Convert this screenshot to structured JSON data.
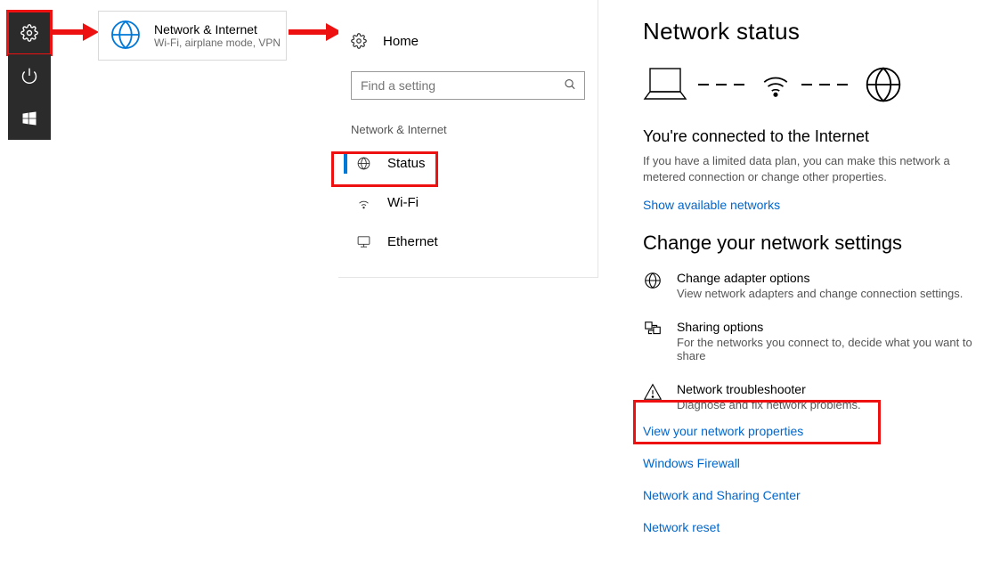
{
  "start": {
    "settings_icon": "settings",
    "power_icon": "power",
    "windows_icon": "windows"
  },
  "category_tile": {
    "title": "Network & Internet",
    "subtitle": "Wi-Fi, airplane mode, VPN"
  },
  "nav": {
    "home_label": "Home",
    "search_placeholder": "Find a setting",
    "section": "Network & Internet",
    "items": {
      "status": "Status",
      "wifi": "Wi-Fi",
      "ethernet": "Ethernet"
    }
  },
  "content": {
    "title": "Network status",
    "connected_heading": "You're connected to the Internet",
    "connected_body": "If you have a limited data plan, you can make this network a metered connection or change other properties.",
    "show_networks": "Show available networks",
    "change_heading": "Change your network settings",
    "adapter": {
      "title": "Change adapter options",
      "sub": "View network adapters and change connection settings."
    },
    "sharing": {
      "title": "Sharing options",
      "sub": "For the networks you connect to, decide what you want to share"
    },
    "trouble": {
      "title": "Network troubleshooter",
      "sub": "Diagnose and fix network problems."
    },
    "links": {
      "props": "View your network properties",
      "firewall": "Windows Firewall",
      "sharing_center": "Network and Sharing Center",
      "reset": "Network reset"
    }
  }
}
